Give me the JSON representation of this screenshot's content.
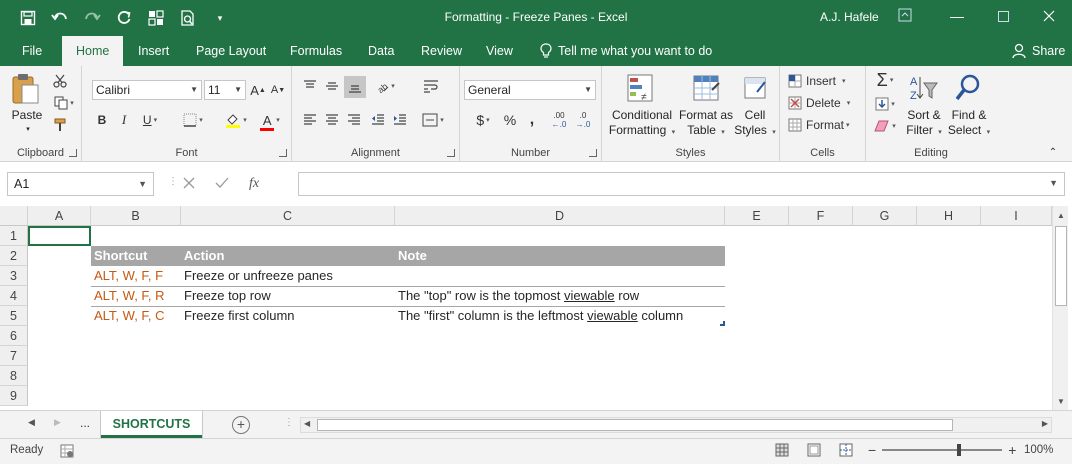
{
  "window": {
    "title": "Formatting - Freeze Panes  -  Excel",
    "user": "A.J. Hafele"
  },
  "tabs": [
    "File",
    "Home",
    "Insert",
    "Page Layout",
    "Formulas",
    "Data",
    "Review",
    "View"
  ],
  "active_tab": "Home",
  "tell_me": "Tell me what you want to do",
  "share": "Share",
  "ribbon": {
    "clipboard": {
      "label": "Clipboard",
      "paste": "Paste"
    },
    "font": {
      "label": "Font",
      "name": "Calibri",
      "size": "11",
      "bold": "B",
      "italic": "I",
      "underline": "U",
      "grow": "A",
      "shrink": "A",
      "font_color": "A"
    },
    "alignment": {
      "label": "Alignment"
    },
    "number": {
      "label": "Number",
      "format": "General",
      "currency": "$",
      "percent": "%",
      "comma": ",",
      "inc_dec": ".00",
      "dec_dec": ".0"
    },
    "styles": {
      "label": "Styles",
      "conditional": [
        "Conditional",
        "Formatting"
      ],
      "format_as": [
        "Format as",
        "Table"
      ],
      "cell_styles": [
        "Cell",
        "Styles"
      ]
    },
    "cells": {
      "label": "Cells",
      "insert": "Insert",
      "delete": "Delete",
      "format": "Format"
    },
    "editing": {
      "label": "Editing",
      "sort": [
        "Sort &",
        "Filter"
      ],
      "find": [
        "Find &",
        "Select"
      ]
    }
  },
  "formula_bar": {
    "name_box": "A1",
    "fx": "fx",
    "formula": ""
  },
  "columns": [
    "A",
    "B",
    "C",
    "D",
    "E",
    "F",
    "G",
    "H",
    "I"
  ],
  "rows": [
    "1",
    "2",
    "3",
    "4",
    "5",
    "6",
    "7",
    "8",
    "9"
  ],
  "table": {
    "headers": [
      "Shortcut",
      "Action",
      "Note"
    ],
    "rows": [
      {
        "shortcut": "ALT, W, F, F",
        "action": "Freeze or unfreeze panes",
        "note_pre": "",
        "note_link": "",
        "note_post": ""
      },
      {
        "shortcut": "ALT, W, F, R",
        "action": "Freeze top row",
        "note_pre": "The \"top\" row is the topmost ",
        "note_link": "viewable",
        "note_post": " row"
      },
      {
        "shortcut": "ALT, W, F, C",
        "action": "Freeze first column",
        "note_pre": "The \"first\" column is the leftmost ",
        "note_link": "viewable",
        "note_post": " column"
      }
    ]
  },
  "sheets": {
    "ellipsis": "...",
    "active": "SHORTCUTS",
    "add": "+"
  },
  "status": {
    "ready": "Ready",
    "zoom": "100%",
    "minus": "−",
    "plus": "+"
  },
  "colors": {
    "excel_green": "#217346",
    "table_header": "#a6a6a6",
    "shortcut_text": "#c65911"
  }
}
